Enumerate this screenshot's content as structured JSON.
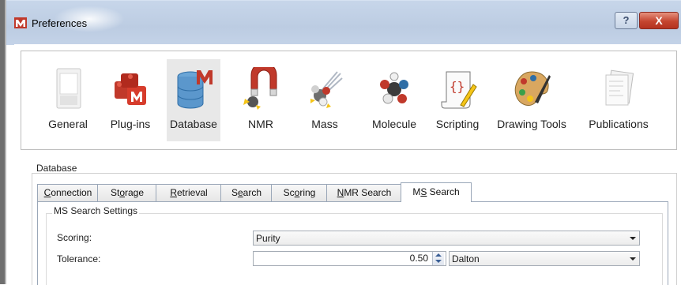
{
  "window": {
    "title": "Preferences",
    "help_label": "?",
    "close_label": "X"
  },
  "categories": [
    {
      "label": "General",
      "icon": "general-icon"
    },
    {
      "label": "Plug-ins",
      "icon": "plugins-icon"
    },
    {
      "label": "Database",
      "icon": "database-icon",
      "selected": true
    },
    {
      "label": "NMR",
      "icon": "nmr-magnet-icon"
    },
    {
      "label": "Mass",
      "icon": "mass-icon"
    },
    {
      "label": "Molecule",
      "icon": "molecule-icon"
    },
    {
      "label": "Scripting",
      "icon": "scripting-icon"
    },
    {
      "label": "Drawing Tools",
      "icon": "palette-icon"
    },
    {
      "label": "Publications",
      "icon": "publications-icon"
    }
  ],
  "section": {
    "title": "Database"
  },
  "tabs": [
    {
      "label": "Connection",
      "key": "C",
      "rest": "onnection"
    },
    {
      "label": "Storage",
      "pre": "St",
      "key": "o",
      "rest": "rage"
    },
    {
      "label": "Retrieval",
      "key": "R",
      "rest": "etrieval"
    },
    {
      "label": "Search",
      "pre": "S",
      "key": "e",
      "rest": "arch"
    },
    {
      "label": "Scoring",
      "pre": "Sc",
      "key": "o",
      "rest": "ring"
    },
    {
      "label": "NMR Search",
      "key": "N",
      "rest": "MR Search"
    },
    {
      "label": "MS Search",
      "pre": "M",
      "key": "S",
      "rest": " Search",
      "active": true
    }
  ],
  "ms_search": {
    "group_title": "MS Search Settings",
    "scoring": {
      "label": "Scoring:",
      "value": "Purity"
    },
    "tolerance": {
      "label": "Tolerance:",
      "value": "0.50",
      "unit": "Dalton"
    }
  },
  "colors": {
    "titlebar": "#bccce2",
    "close_button": "#c5452f",
    "accent": "#3a5f96"
  }
}
